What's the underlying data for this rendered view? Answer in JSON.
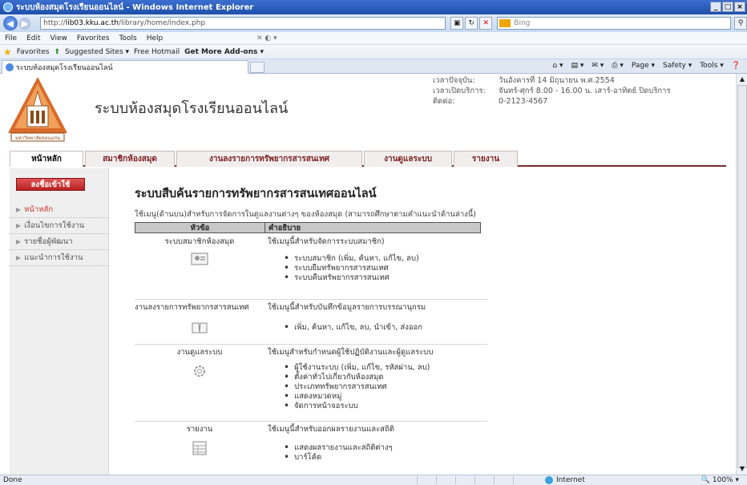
{
  "window": {
    "title": "ระบบห้องสมุดโรงเรียนออนไลน์ - Windows Internet Explorer",
    "buttons": [
      "_",
      "□",
      "×"
    ]
  },
  "address": {
    "url_prefix": "http://",
    "url_domain": "lib03.kku.ac.th",
    "url_path": "/library/home/index.php",
    "search_placeholder": "Bing"
  },
  "menu": {
    "items": [
      "File",
      "Edit",
      "View",
      "Favorites",
      "Tools",
      "Help"
    ]
  },
  "favorites": {
    "label": "Favorites",
    "suggested": "Suggested Sites ▾",
    "hotmail": "Free Hotmail",
    "addons": "Get More Add-ons ▾"
  },
  "tabs": {
    "active_tab": "ระบบห้องสมุดโรงเรียนออนไลน์",
    "commands": [
      "Page ▾",
      "Safety ▾",
      "Tools ▾"
    ]
  },
  "header": {
    "site_title": "ระบบห้องสมุดโรงเรียนออนไลน์",
    "logo_text": "มหาวิทยาลัยขอนแก่น",
    "info": [
      {
        "key": "เวลาปัจจุบัน:",
        "value": "วันอังคารที่ 14 มิถุนายน พ.ศ.2554"
      },
      {
        "key": "เวลาเปิดบริการ:",
        "value": "จันทร์-ศุกร์ 8.00 - 16.00 น. เสาร์-อาทิตย์ ปิดบริการ"
      },
      {
        "key": "ติดต่อ:",
        "value": "0-2123-4567"
      }
    ]
  },
  "nav": {
    "items": [
      "หน้าหลัก",
      "สมาชิกห้องสมุด",
      "งานลงรายการทรัพยากรสารสนเทศ",
      "งานดูแลระบบ",
      "รายงาน"
    ]
  },
  "sidebar": {
    "login": "ลงชื่อเข้าใช้",
    "items": [
      "หน้าหลัก",
      "เงื่อนไขการใช้งาน",
      "รายชื่อผู้พัฒนา",
      "แนะนำการใช้งาน"
    ]
  },
  "main": {
    "heading": "ระบบสืบค้นรายการทรัพยากรสารสนเทศออนไลน์",
    "description": "ใช้เมนู(ด้านบน)สำหรับการจัดการในดูแลงานต่างๆ ของห้องสมุด (สามารถศึกษาตามคำแนะนำด้านล่างนี้)",
    "col_topic": "หัวข้อ",
    "col_desc": "คำอธิบาย",
    "sections": [
      {
        "name": "ระบบสมาชิกห้องสมุด",
        "desc": "ใช้เมนูนี้สำหรับจัดการระบบสมาชิก)",
        "items": [
          "ระบบสมาชิก (เพิ่ม, ค้นหา, แก้ไข, ลบ)",
          "ระบบยืมทรัพยากรสารสนเทศ",
          "ระบบคืนทรัพยากรสารสนเทศ"
        ]
      },
      {
        "name": "งานลงรายการทรัพยากรสารสนเทศ",
        "desc": "ใช้เมนูนี้สำหรับบันทึกข้อมูลรายการบรรณานุกรม",
        "items": [
          "เพิ่ม, ค้นหา, แก้ไข, ลบ, นำเข้า, ส่งออก"
        ]
      },
      {
        "name": "งานดูแลระบบ",
        "desc": "ใช้เมนูสำหรับกำหนดผู้ใช้ปฏิบัติงานและผู้ดูแลระบบ",
        "items": [
          "ผู้ใช้งานระบบ (เพิ่ม, แก้ไข, รหัสผ่าน, ลบ)",
          "ตั้งค่าทั่วไปเกี่ยวกับห้องสมุด",
          "ประเภททรัพยากรสารสนเทศ",
          "แสดงหมวดหมู่",
          "จัดการหน้าจอระบบ"
        ]
      },
      {
        "name": "รายงาน",
        "desc": "ใช้เมนูนี้สำหรับออกผลรายงานและสถิติ",
        "items": [
          "แสดงผลรายงานและสถิติต่างๆ",
          "บาร์โค้ด"
        ]
      }
    ]
  },
  "status": {
    "left": "Done",
    "zone": "Internet",
    "zoom": "100%"
  },
  "colors": {
    "titlebar": "#1f4fa8",
    "nav_accent": "#7a2a2a",
    "login_button": "#c43030",
    "sidebar_active": "#c43a2a"
  }
}
